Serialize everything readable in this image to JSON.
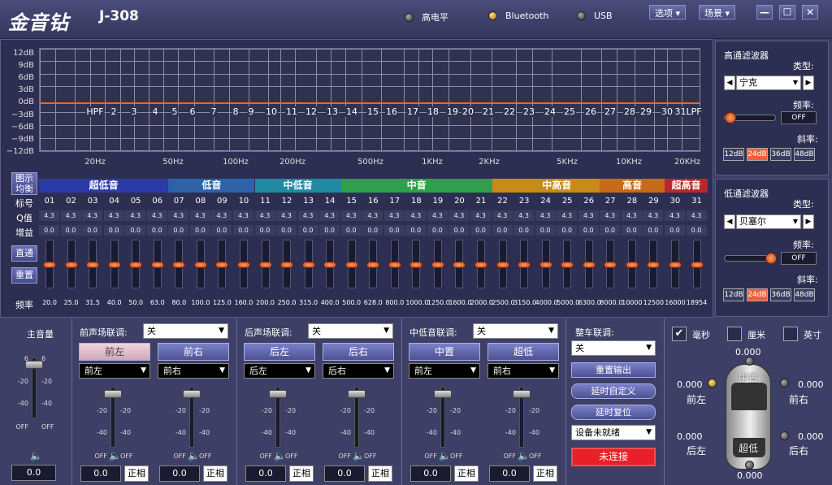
{
  "app": {
    "logo": "金音钻",
    "model": "J-308"
  },
  "indicators": [
    {
      "label": "高电平",
      "on": false
    },
    {
      "label": "Bluetooth",
      "on": true
    },
    {
      "label": "USB",
      "on": false
    }
  ],
  "menu": {
    "options": "选项 ▾",
    "scene": "场景 ▾"
  },
  "window": {
    "min": "—",
    "max": "☐",
    "close": "✕"
  },
  "graph": {
    "db_labels": [
      "12dB",
      "9dB",
      "6dB",
      "3dB",
      "0dB",
      "−3dB",
      "−6dB",
      "−9dB",
      "−12dB"
    ],
    "hz_labels": [
      "20Hz",
      "50Hz",
      "100Hz",
      "200Hz",
      "500Hz",
      "1KHz",
      "2KHz",
      "5KHz",
      "10KHz",
      "20KHz"
    ],
    "band_labels": [
      "HPF",
      "2",
      "3",
      "4",
      "5",
      "6",
      "7",
      "8",
      "9",
      "10",
      "11",
      "12",
      "13",
      "14",
      "15",
      "16",
      "17",
      "18",
      "19",
      "20",
      "21",
      "22",
      "23",
      "24",
      "25",
      "26",
      "27",
      "28",
      "29",
      "30",
      "31LPF"
    ]
  },
  "left_buttons": {
    "graphic_eq": "图示\n均衡",
    "row_number": "标号",
    "q": "Q值",
    "gain": "增益",
    "bypass": "直通",
    "reset": "重置",
    "freq": "频率"
  },
  "groups": [
    {
      "label": "超低音",
      "from": 1,
      "to": 6,
      "color": "#2a3aa8"
    },
    {
      "label": "低音",
      "from": 7,
      "to": 10,
      "color": "#2d62a8"
    },
    {
      "label": "中低音",
      "from": 11,
      "to": 14,
      "color": "#1f8aa0"
    },
    {
      "label": "中音",
      "from": 15,
      "to": 21,
      "color": "#2ea04a"
    },
    {
      "label": "中高音",
      "from": 22,
      "to": 27,
      "color": "#c88a18"
    },
    {
      "label": "高音",
      "from": 27,
      "to": 29,
      "color": "#c86a18"
    },
    {
      "label": "超高音",
      "from": 30,
      "to": 31,
      "color": "#b8282a"
    }
  ],
  "bands": {
    "numbers": [
      "01",
      "02",
      "03",
      "04",
      "05",
      "06",
      "07",
      "08",
      "09",
      "10",
      "11",
      "12",
      "13",
      "14",
      "15",
      "16",
      "17",
      "18",
      "19",
      "20",
      "21",
      "22",
      "23",
      "24",
      "25",
      "26",
      "27",
      "28",
      "29",
      "30",
      "31"
    ],
    "q_values": [
      "4.3",
      "4.3",
      "4.3",
      "4.3",
      "4.3",
      "4.3",
      "4.3",
      "4.3",
      "4.3",
      "4.3",
      "4.3",
      "4.3",
      "4.3",
      "4.3",
      "4.3",
      "4.3",
      "4.3",
      "4.3",
      "4.3",
      "4.3",
      "4.3",
      "4.3",
      "4.3",
      "4.3",
      "4.3",
      "4.3",
      "4.3",
      "4.3",
      "4.3",
      "4.3",
      "4.3"
    ],
    "gains": [
      "0.0",
      "0.0",
      "0.0",
      "0.0",
      "0.0",
      "0.0",
      "0.0",
      "0.0",
      "0.0",
      "0.0",
      "0.0",
      "0.0",
      "0.0",
      "0.0",
      "0.0",
      "0.0",
      "0.0",
      "0.0",
      "0.0",
      "0.0",
      "0.0",
      "0.0",
      "0.0",
      "0.0",
      "0.0",
      "0.0",
      "0.0",
      "0.0",
      "0.0",
      "0.0",
      "0.0"
    ],
    "freqs": [
      "20.0",
      "25.0",
      "31.5",
      "40.0",
      "50.0",
      "63.0",
      "80.0",
      "100.0",
      "125.0",
      "160.0",
      "200.0",
      "250.0",
      "315.0",
      "400.0",
      "500.0",
      "628.0",
      "800.0",
      "1000.0",
      "1250.0",
      "1600.0",
      "2000.0",
      "2500.0",
      "3150.0",
      "4000.0",
      "5000.0",
      "6300.0",
      "8000.0",
      "10000",
      "12500",
      "16000",
      "18954"
    ]
  },
  "hpf": {
    "title": "高通滤波器",
    "type_label": "类型:",
    "type_value": "宁克",
    "freq_label": "频率:",
    "freq_value": "OFF",
    "slope_label": "斜率:",
    "slopes": [
      "12dB",
      "24dB",
      "36dB",
      "48dB"
    ],
    "active_slope": 1
  },
  "lpf": {
    "title": "低通滤波器",
    "type_label": "类型:",
    "type_value": "贝塞尔",
    "freq_label": "频率:",
    "freq_value": "OFF",
    "slope_label": "斜率:",
    "slopes": [
      "12dB",
      "24dB",
      "36dB",
      "48dB"
    ],
    "active_slope": 1
  },
  "bottom": {
    "master": {
      "label": "主音量",
      "ticks": [
        "6",
        "-20",
        "-40",
        "OFF"
      ],
      "ticks_r": [
        "6",
        "-20",
        "-40",
        "OFF"
      ],
      "value": "0.0"
    },
    "front": {
      "label": "前声场联调:",
      "select": "关",
      "ch1": "前左",
      "ch2": "前右",
      "sel1": "前左",
      "sel2": "前右",
      "val1": "0.0",
      "val2": "0.0",
      "phase": "正相"
    },
    "rear": {
      "label": "后声场联调:",
      "select": "关",
      "ch1": "后左",
      "ch2": "后右",
      "sel1": "后左",
      "sel2": "后右",
      "val1": "0.0",
      "val2": "0.0",
      "phase": "正相"
    },
    "midlow": {
      "label": "中低音联调:",
      "select": "关",
      "ch1": "中置",
      "ch2": "超低",
      "sel1": "前左",
      "sel2": "前右",
      "val1": "0.0",
      "val2": "0.0",
      "phase": "正相"
    },
    "car": {
      "label": "整车联调:",
      "select": "关",
      "reset_output": "重置输出",
      "delay_custom": "延时自定义",
      "delay_reset": "延时复位",
      "device_status": "设备未就绪",
      "connect": "未连接"
    },
    "units": [
      {
        "label": "毫秒",
        "checked": true
      },
      {
        "label": "厘米",
        "checked": false
      },
      {
        "label": "英寸",
        "checked": false
      }
    ],
    "car_positions": {
      "top": "0.000",
      "center": "中置",
      "front_left_val": "0.000",
      "front_left": "前左",
      "front_right_val": "0.000",
      "front_right": "前右",
      "rear_left_val": "0.000",
      "rear_left": "后左",
      "rear_right_val": "0.000",
      "rear_right": "后右",
      "sub": "超低",
      "bottom": "0.000"
    }
  }
}
